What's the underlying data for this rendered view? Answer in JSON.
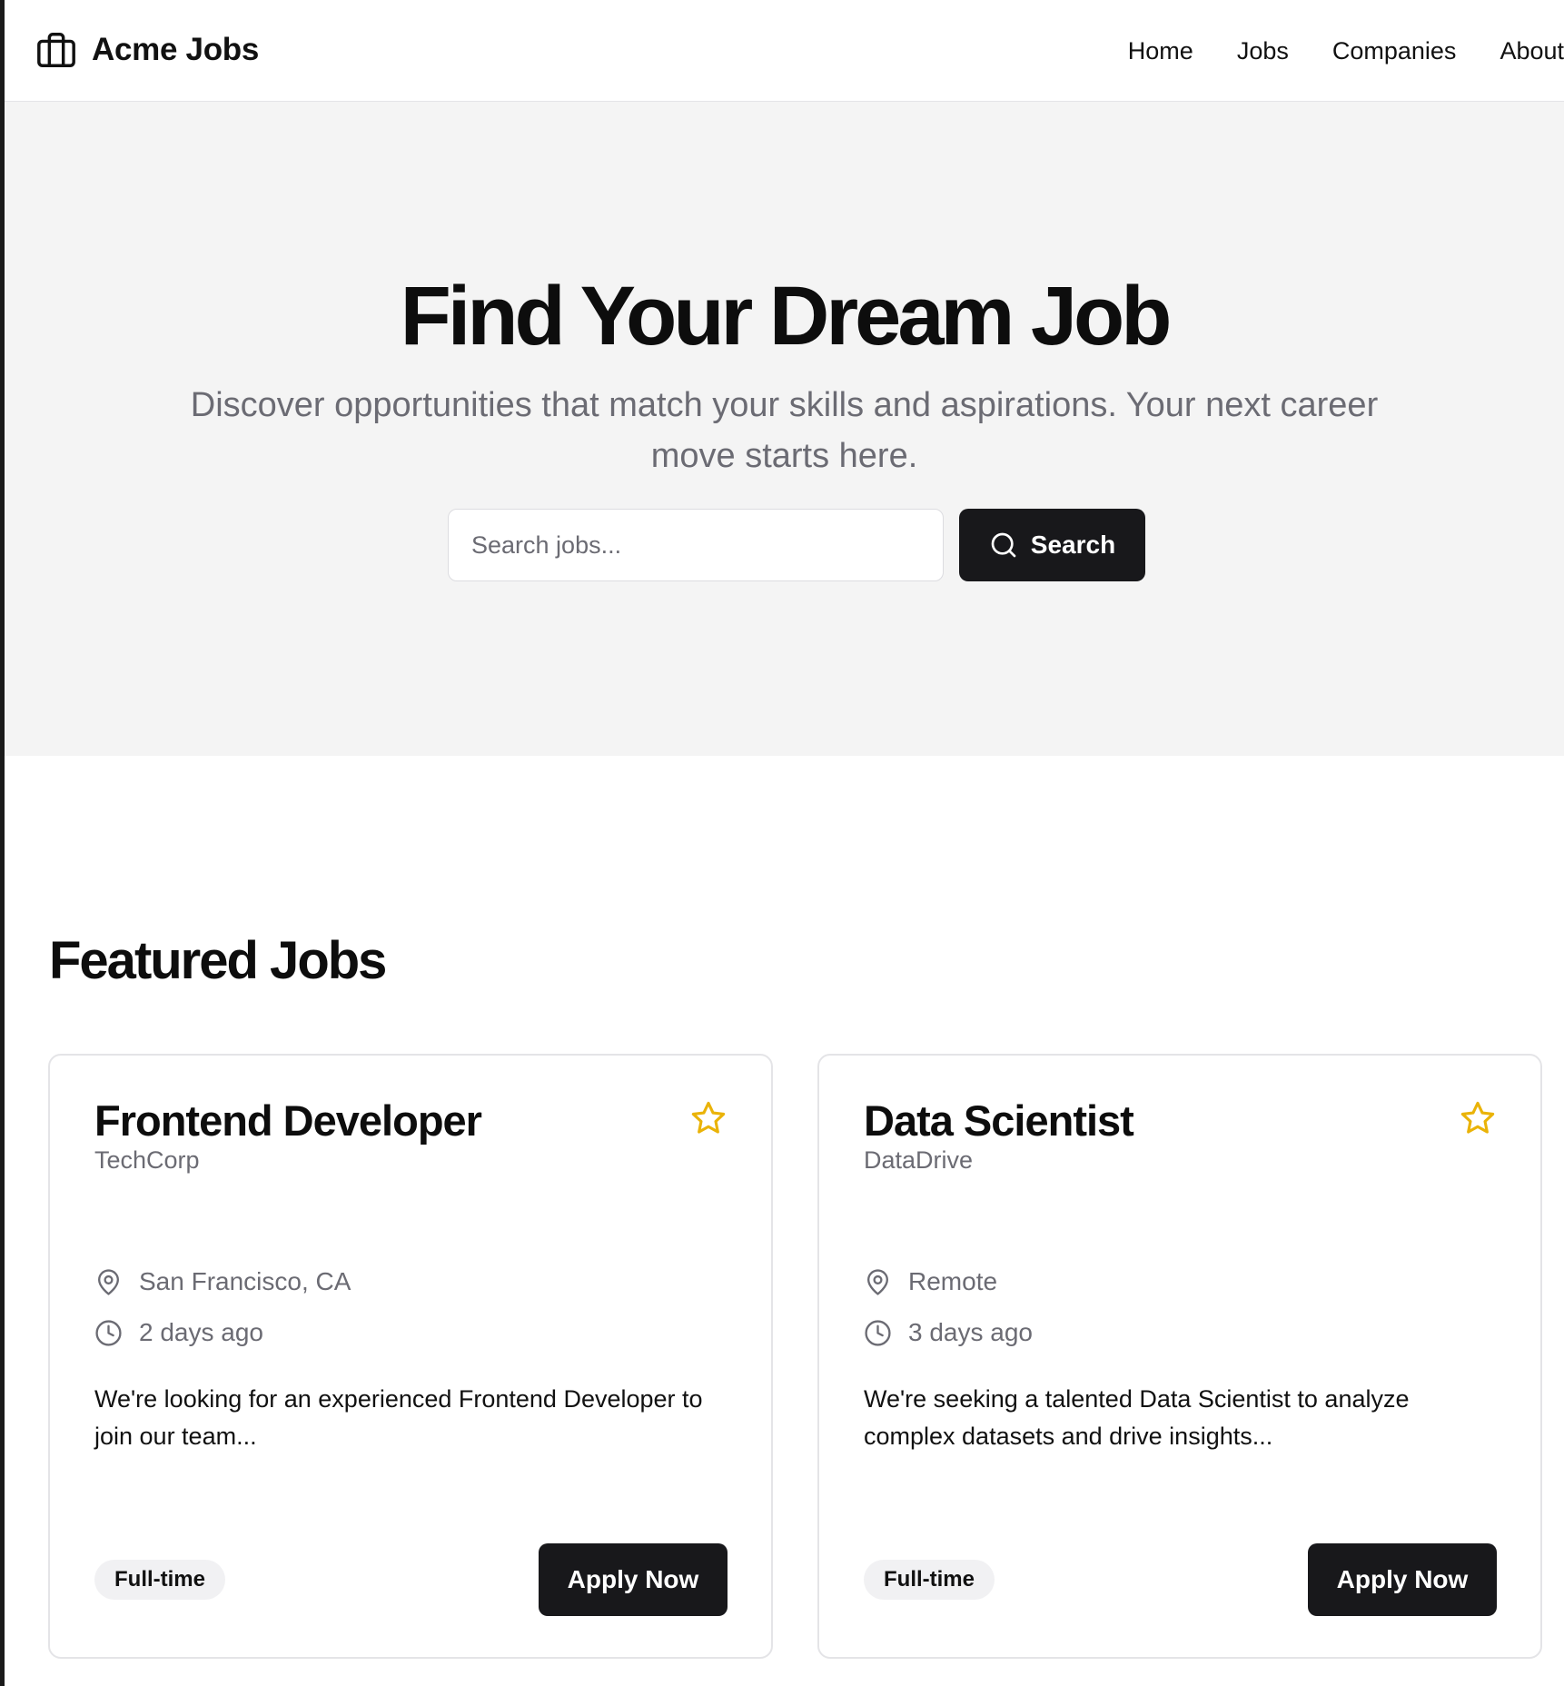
{
  "header": {
    "brand": "Acme Jobs",
    "brand_icon": "briefcase-icon",
    "nav": [
      "Home",
      "Jobs",
      "Companies",
      "About"
    ]
  },
  "hero": {
    "title": "Find Your Dream Job",
    "subtitle": "Discover opportunities that match your skills and aspirations. Your next career move starts here.",
    "search": {
      "placeholder": "Search jobs...",
      "value": "",
      "button_label": "Search",
      "button_icon": "search-icon"
    }
  },
  "featured": {
    "title": "Featured Jobs",
    "jobs": [
      {
        "title": "Frontend Developer",
        "company": "TechCorp",
        "location": "San Francisco, CA",
        "posted": "2 days ago",
        "description": "We're looking for an experienced Frontend Developer to join our team...",
        "type": "Full-time",
        "apply_label": "Apply Now",
        "favorited": false
      },
      {
        "title": "Data Scientist",
        "company": "DataDrive",
        "location": "Remote",
        "posted": "3 days ago",
        "description": "We're seeking a talented Data Scientist to analyze complex datasets and drive insights...",
        "type": "Full-time",
        "apply_label": "Apply Now",
        "favorited": false
      }
    ]
  },
  "colors": {
    "primary": "#18181b",
    "hero_background": "#f4f4f4",
    "muted_text": "#6b6b73",
    "star": "#eab308",
    "border": "#e4e4e7"
  }
}
